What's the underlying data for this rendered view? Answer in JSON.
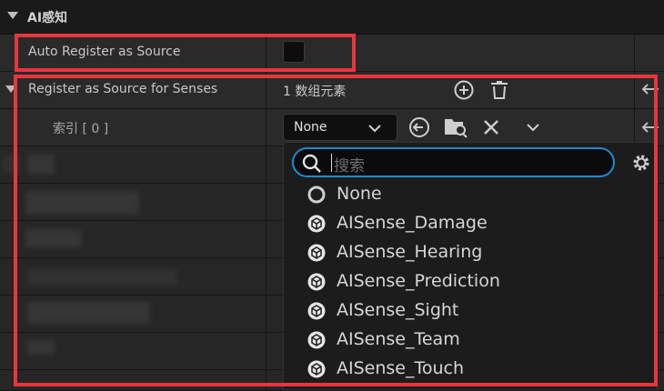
{
  "section": {
    "title": "AI感知"
  },
  "auto_register": {
    "label": "Auto Register as Source"
  },
  "register_senses": {
    "label": "Register as Source for Senses",
    "count_text": "1 数组元素"
  },
  "index_row": {
    "label": "索引 [ 0 ]",
    "selected_value": "None"
  },
  "dropdown": {
    "search_placeholder": "搜索",
    "options": [
      {
        "label": "None",
        "icon": "none-circle-icon"
      },
      {
        "label": "AISense_Damage",
        "icon": "cube-icon"
      },
      {
        "label": "AISense_Hearing",
        "icon": "cube-icon"
      },
      {
        "label": "AISense_Prediction",
        "icon": "cube-icon"
      },
      {
        "label": "AISense_Sight",
        "icon": "cube-icon"
      },
      {
        "label": "AISense_Team",
        "icon": "cube-icon"
      },
      {
        "label": "AISense_Touch",
        "icon": "cube-icon"
      }
    ]
  },
  "colors": {
    "highlight_border": "#e8363d",
    "search_focus": "#1f8bd6",
    "panel_bg": "#242424"
  }
}
